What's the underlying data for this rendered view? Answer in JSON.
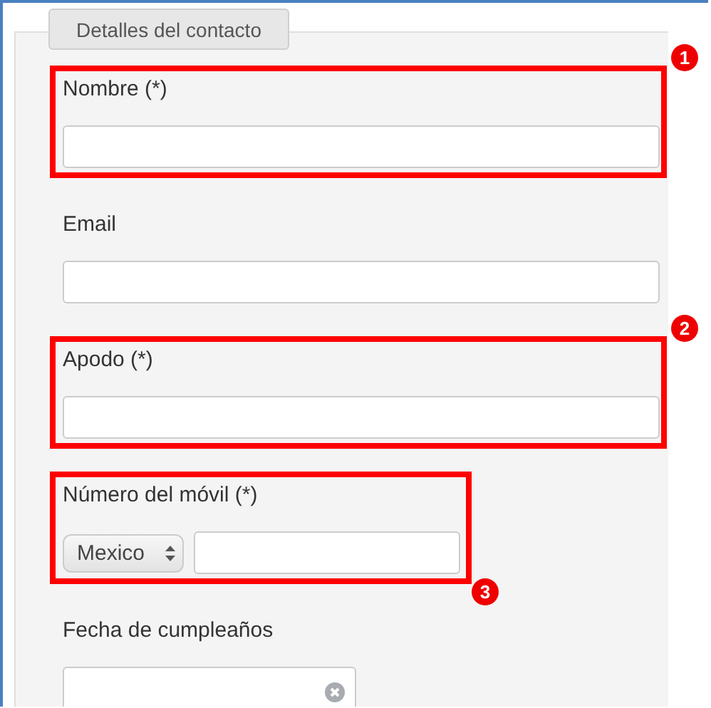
{
  "legend": "Detalles del contacto",
  "fields": [
    {
      "kind": "text",
      "label": "Nombre (*)",
      "highlighted": true,
      "callout": "1"
    },
    {
      "kind": "text",
      "label": "Email",
      "highlighted": false
    },
    {
      "kind": "text",
      "label": "Apodo (*)",
      "highlighted": true,
      "callout": "2"
    },
    {
      "kind": "phone",
      "label": "Número del móvil (*)",
      "country": "Mexico",
      "highlighted": true,
      "callout": "3"
    },
    {
      "kind": "date",
      "label": "Fecha de cumpleaños",
      "highlighted": false
    }
  ]
}
